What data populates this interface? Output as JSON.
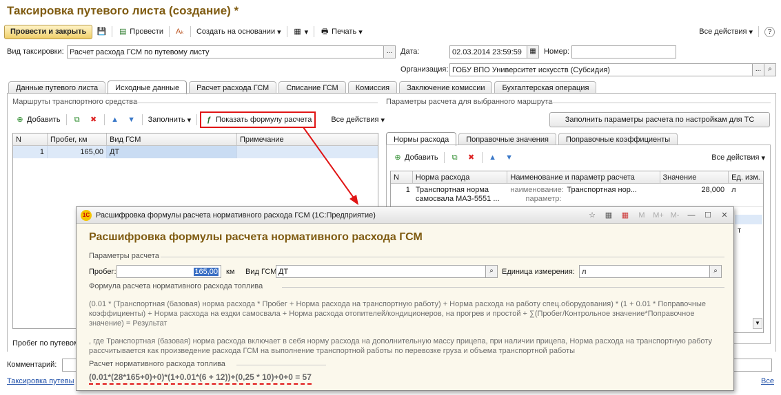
{
  "window": {
    "title": "Таксировка путевого листа (создание) *"
  },
  "toolbar": {
    "post_close": "Провести и закрыть",
    "post": "Провести",
    "create_based": "Создать на основании",
    "print": "Печать",
    "all_actions": "Все действия",
    "help": "?"
  },
  "header": {
    "type_label": "Вид таксировки:",
    "type_value": "Расчет расхода ГСМ по путевому листу",
    "date_label": "Дата:",
    "date_value": "02.03.2014 23:59:59",
    "number_label": "Номер:",
    "number_value": "",
    "org_label": "Организация:",
    "org_value": "ГОБУ ВПО Университет искусств (Субсидия)"
  },
  "tabs": [
    "Данные путевого листа",
    "Исходные данные",
    "Расчет расхода ГСМ",
    "Списание ГСМ",
    "Комиссия",
    "Заключение комиссии",
    "Бухгалтерская операция"
  ],
  "routes": {
    "title": "Маршруты транспортного средства",
    "add": "Добавить",
    "fill": "Заполнить",
    "show_formula": "Показать формулу расчета",
    "all_actions": "Все действия",
    "columns": [
      "N",
      "Пробег, км",
      "Вид ГСМ",
      "Примечание"
    ],
    "rows": [
      {
        "n": "1",
        "mileage": "165,00",
        "fuel": "ДТ",
        "note": ""
      }
    ],
    "footer_label": "Пробег по путевому"
  },
  "params": {
    "title": "Параметры расчета для выбранного маршрута",
    "fill_button": "Заполнить параметры расчета по настройкам для ТС",
    "tabs": [
      "Нормы расхода",
      "Поправочные значения",
      "Поправочные коэффициенты"
    ],
    "add": "Добавить",
    "all_actions": "Все действия",
    "columns": [
      "N",
      "Норма расхода",
      "Наименование и параметр расчета",
      "Значение",
      "Ед. изм."
    ],
    "row": {
      "n": "1",
      "norm": "Транспортная норма самосвала МАЗ-5551 ...",
      "name_label": "наименование:",
      "name_value": "Транспортная нор...",
      "param_label": "параметр:",
      "value": "28,000",
      "unit": "л"
    },
    "row2_unit": "т"
  },
  "footer": {
    "comment_label": "Комментарий:",
    "link": "Таксировка путевы",
    "all_link": "Все"
  },
  "dialog": {
    "window_title": "Расшифровка формулы расчета нормативного расхода ГСМ  (1С:Предприятие)",
    "heading": "Расшифровка формулы расчета нормативного расхода ГСМ",
    "params_title": "Параметры расчета",
    "mileage_label": "Пробег:",
    "mileage_value": "165,00",
    "km": "км",
    "fuel_label": "Вид ГСМ:",
    "fuel_value": "ДТ",
    "unit_label": "Единица измерения:",
    "unit_value": "л",
    "formula_title": "Формула расчета нормативного расхода топлива",
    "formula_text": "(0.01 * (Транспортная (базовая) норма расхода * Пробег +  Норма расхода на транспортную работу) + Норма расхода на работу спец.оборудования) * (1 + 0.01 * Поправочные коэффициенты) + Норма расхода на ездки самосвала + Норма расхода отопителей/кондиционеров, на прогрев и простой + ∑(Пробег/Контрольное значение*Поправочное значение) = Результат",
    "note_text": ", где Транспортная (базовая) норма расхода включает в себя норму расхода на дополнительную массу прицепа, при наличии прицепа, Норма расхода на транспортную работу рассчитывается как произведение расхода ГСМ на выполнение транспортной работы по перевозке груза и объема транспортной работы",
    "calc_title": "Расчет нормативного расхода топлива",
    "calc_value": "(0.01*(28*165+0)+0)*(1+0.01*(6 + 12))+(0,25 * 10)+0+0 = 57",
    "mbuttons": [
      "M",
      "M+",
      "M-"
    ]
  },
  "colors": {
    "title": "#7f5b11",
    "highlight": "#e01515",
    "selection": "#dde9f8"
  }
}
